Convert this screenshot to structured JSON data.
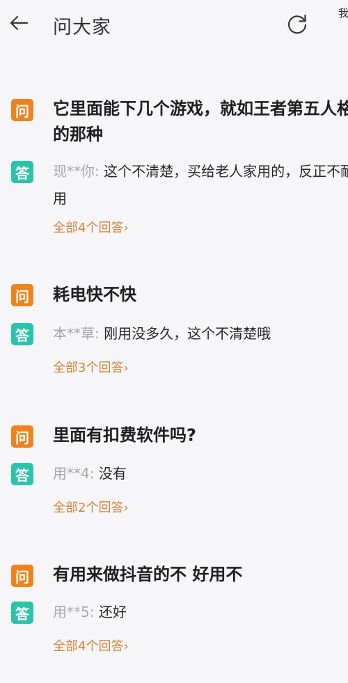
{
  "header": {
    "title": "问大家",
    "right_text": "我的问"
  },
  "colors": {
    "question_badge": "#f0821e",
    "answer_badge": "#2cc3ab",
    "more_link": "#d1843a"
  },
  "icons": {
    "back": "back-arrow-icon",
    "refresh": "refresh-icon"
  },
  "items": [
    {
      "q_badge": "问",
      "question": "它里面能下几个游戏，就如王者第五人格的那种",
      "a_badge": "答",
      "user": "现**你:",
      "answer": " 这个不清楚，买给老人家用的，反正不耐用",
      "more": "全部4个回答›"
    },
    {
      "q_badge": "问",
      "question": "耗电快不快",
      "a_badge": "答",
      "user": "本**草:",
      "answer": " 刚用没多久，这个不清楚哦",
      "more": "全部3个回答›"
    },
    {
      "q_badge": "问",
      "question": "里面有扣费软件吗?",
      "a_badge": "答",
      "user": "用**4:",
      "answer": " 没有",
      "more": "全部2个回答›"
    },
    {
      "q_badge": "问",
      "question": "有用来做抖音的不 好用不",
      "a_badge": "答",
      "user": "用**5:",
      "answer": " 还好",
      "more": "全部4个回答›"
    }
  ]
}
